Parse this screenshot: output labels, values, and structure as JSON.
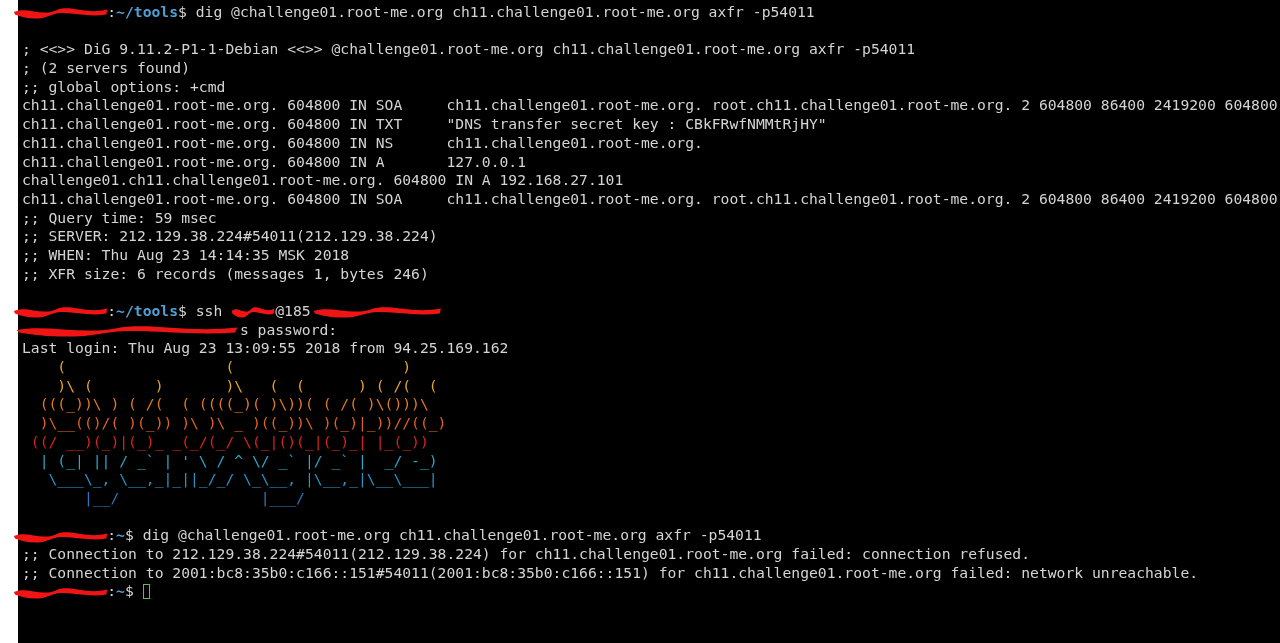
{
  "terminal": {
    "lines": [
      {
        "kind": "segments",
        "segments": [
          {
            "kind": "redacted-name"
          },
          {
            "kind": "plain",
            "text": ":"
          },
          {
            "kind": "path",
            "text": "~/tools"
          },
          {
            "kind": "plain",
            "text": "$ dig @challenge01.root-me.org ch11.challenge01.root-me.org axfr -p54011"
          }
        ]
      },
      {
        "kind": "blank"
      },
      {
        "kind": "output",
        "text": "; <<>> DiG 9.11.2-P1-1-Debian <<>> @challenge01.root-me.org ch11.challenge01.root-me.org axfr -p54011"
      },
      {
        "kind": "output",
        "text": "; (2 servers found)"
      },
      {
        "kind": "output",
        "text": ";; global options: +cmd"
      },
      {
        "kind": "output",
        "text": "ch11.challenge01.root-me.org. 604800 IN SOA     ch11.challenge01.root-me.org. root.ch11.challenge01.root-me.org. 2 604800 86400 2419200 604800"
      },
      {
        "kind": "output",
        "text": "ch11.challenge01.root-me.org. 604800 IN TXT     \"DNS transfer secret key : CBkFRwfNMMtRjHY\""
      },
      {
        "kind": "output",
        "text": "ch11.challenge01.root-me.org. 604800 IN NS      ch11.challenge01.root-me.org."
      },
      {
        "kind": "output",
        "text": "ch11.challenge01.root-me.org. 604800 IN A       127.0.0.1"
      },
      {
        "kind": "output",
        "text": "challenge01.ch11.challenge01.root-me.org. 604800 IN A 192.168.27.101"
      },
      {
        "kind": "output",
        "text": "ch11.challenge01.root-me.org. 604800 IN SOA     ch11.challenge01.root-me.org. root.ch11.challenge01.root-me.org. 2 604800 86400 2419200 604800"
      },
      {
        "kind": "output",
        "text": ";; Query time: 59 msec"
      },
      {
        "kind": "output",
        "text": ";; SERVER: 212.129.38.224#54011(212.129.38.224)"
      },
      {
        "kind": "output",
        "text": ";; WHEN: Thu Aug 23 14:14:35 MSK 2018"
      },
      {
        "kind": "output",
        "text": ";; XFR size: 6 records (messages 1, bytes 246)"
      },
      {
        "kind": "blank"
      },
      {
        "kind": "segments",
        "segments": [
          {
            "kind": "redacted-name"
          },
          {
            "kind": "plain",
            "text": ":"
          },
          {
            "kind": "path",
            "text": "~/tools"
          },
          {
            "kind": "plain",
            "text": "$ ssh "
          },
          {
            "kind": "redacted-user"
          },
          {
            "kind": "plain",
            "text": "@185"
          },
          {
            "kind": "redacted-host"
          }
        ]
      },
      {
        "kind": "segments",
        "segments": [
          {
            "kind": "redacted-login"
          },
          {
            "kind": "plain",
            "text": "s password:"
          }
        ]
      },
      {
        "kind": "output",
        "text": "Last login: Thu Aug 23 13:09:55 2018 from 94.25.169.162"
      },
      {
        "kind": "art",
        "color": "#e8a723",
        "text": "    (                  (                   )"
      },
      {
        "kind": "art",
        "color": "#e8a723",
        "text": "    )\\ (       )       )\\   (  (      ) ( /(  ("
      },
      {
        "kind": "art",
        "color": "#e47a1e",
        "text": "  (((_))\\ ) ( /(  ( ((((_)( )\\))( ( /( )\\()))\\"
      },
      {
        "kind": "art",
        "color": "#e2631c",
        "text": "  )\\__(()/( )(_)) )\\ )\\ _ )((_))\\ )(_)|_))//((_)"
      },
      {
        "kind": "art",
        "color": "#d8231e",
        "text": " ((/ __)(_)|(_)_ _(_/(_/ \\(_|()(_|(_)_| |_(_))"
      },
      {
        "kind": "art",
        "color": "#2aa8c8",
        "text": "  | (_| || / _` | ' \\ / ^ \\/ _` |/ _` |  _/ -_)"
      },
      {
        "kind": "art",
        "color": "#2496c8",
        "text": "   \\___\\_, \\__,_|_||_/_/ \\_\\__, |\\__,_|\\__\\___|"
      },
      {
        "kind": "art",
        "color": "#2a78c0",
        "text": "       |__/                |___/"
      },
      {
        "kind": "blank"
      },
      {
        "kind": "segments",
        "segments": [
          {
            "kind": "redacted-name"
          },
          {
            "kind": "plain",
            "text": ":"
          },
          {
            "kind": "path",
            "text": "~"
          },
          {
            "kind": "plain",
            "text": "$ dig @challenge01.root-me.org ch11.challenge01.root-me.org axfr -p54011"
          }
        ]
      },
      {
        "kind": "output",
        "text": ";; Connection to 212.129.38.224#54011(212.129.38.224) for ch11.challenge01.root-me.org failed: connection refused."
      },
      {
        "kind": "output",
        "text": ";; Connection to 2001:bc8:35b0:c166::151#54011(2001:bc8:35b0:c166::151) for ch11.challenge01.root-me.org failed: network unreachable."
      },
      {
        "kind": "segments",
        "segments": [
          {
            "kind": "redacted-name"
          },
          {
            "kind": "plain",
            "text": ":"
          },
          {
            "kind": "path",
            "text": "~"
          },
          {
            "kind": "plain",
            "text": "$ "
          },
          {
            "kind": "cursor"
          }
        ]
      }
    ]
  }
}
